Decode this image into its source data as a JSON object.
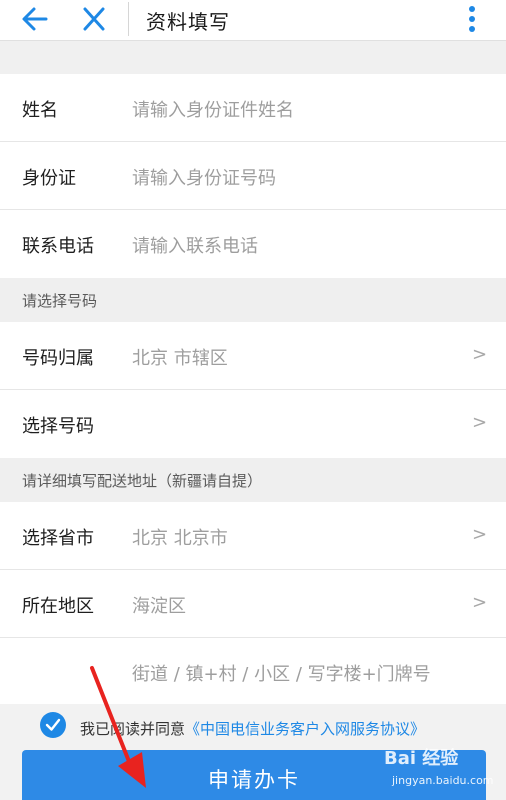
{
  "header": {
    "title": "资料填写",
    "back_icon": "arrow-left-icon",
    "close_icon": "close-icon",
    "more_icon": "more-vertical-icon",
    "accent": "#1e88e5"
  },
  "personal": {
    "name": {
      "label": "姓名",
      "placeholder": "请输入身份证件姓名"
    },
    "id_card": {
      "label": "身份证",
      "placeholder": "请输入身份证号码"
    },
    "phone": {
      "label": "联系电话",
      "placeholder": "请输入联系电话"
    }
  },
  "number_section": {
    "heading": "请选择号码",
    "location": {
      "label": "号码归属",
      "value": "北京 市辖区",
      "chevron": ">"
    },
    "pick": {
      "label": "选择号码",
      "chevron": ">"
    }
  },
  "address_section": {
    "heading": "请详细填写配送地址（新疆请自提）",
    "province": {
      "label": "选择省市",
      "value": "北京 北京市",
      "chevron": ">"
    },
    "district": {
      "label": "所在地区",
      "value": "海淀区",
      "chevron": ">"
    },
    "street": {
      "placeholder": "街道 / 镇+村 / 小区 / 写字楼+门牌号"
    }
  },
  "agreement": {
    "prefix": "我已阅读并同意",
    "link": "《中国电信业务客户入网服务协议》",
    "checked": true
  },
  "submit": {
    "label": "申请办卡",
    "color": "#2e8ae6"
  },
  "watermark": {
    "brand": "Bai 经验",
    "url": "jingyan.baidu.com"
  }
}
